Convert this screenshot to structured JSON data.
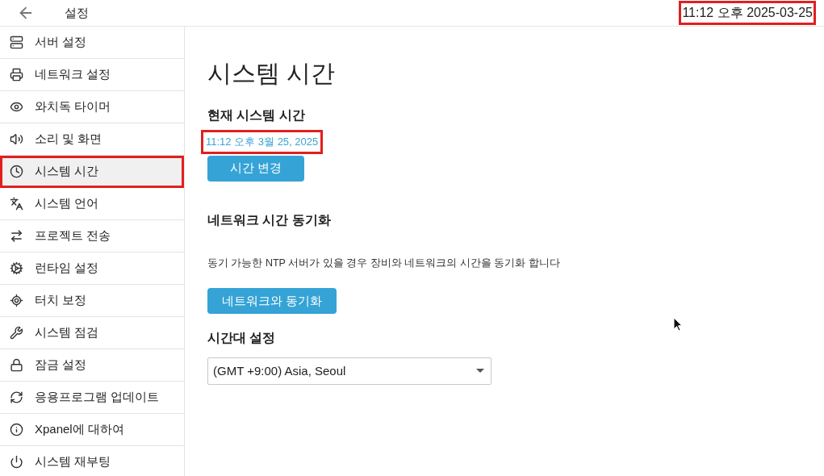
{
  "header": {
    "title": "설정",
    "clock": {
      "text": "11:12 오후 2025-03-25",
      "highlighted": true
    }
  },
  "sidebar": {
    "items": [
      {
        "label": "서버 설정",
        "selected": false,
        "highlighted": false
      },
      {
        "label": "네트워크 설정",
        "selected": false,
        "highlighted": false
      },
      {
        "label": "와치독 타이머",
        "selected": false,
        "highlighted": false
      },
      {
        "label": "소리 및 화면",
        "selected": false,
        "highlighted": false
      },
      {
        "label": "시스템 시간",
        "selected": true,
        "highlighted": true
      },
      {
        "label": "시스템 언어",
        "selected": false,
        "highlighted": false
      },
      {
        "label": "프로젝트 전송",
        "selected": false,
        "highlighted": false
      },
      {
        "label": "런타임 설정",
        "selected": false,
        "highlighted": false
      },
      {
        "label": "터치 보정",
        "selected": false,
        "highlighted": false
      },
      {
        "label": "시스템 점검",
        "selected": false,
        "highlighted": false
      },
      {
        "label": "잠금 설정",
        "selected": false,
        "highlighted": false
      },
      {
        "label": "응용프로그램 업데이트",
        "selected": false,
        "highlighted": false
      },
      {
        "label": "Xpanel에 대하여",
        "selected": false,
        "highlighted": false
      },
      {
        "label": "시스템 재부팅",
        "selected": false,
        "highlighted": false
      }
    ]
  },
  "content": {
    "title": "시스템 시간",
    "current_time": {
      "heading": "현재 시스템 시간",
      "value": "11:12 오후 3월 25, 2025",
      "highlighted": true,
      "button": "시간 변경"
    },
    "network_sync": {
      "heading": "네트워크 시간 동기화",
      "description": "동기 가능한 NTP 서버가 있을 경우 장비와 네트워크의 시간을 동기화 합니다",
      "button": "네트워크와 동기화"
    },
    "timezone": {
      "heading": "시간대 설정",
      "value": "(GMT +9:00) Asia, Seoul"
    }
  }
}
